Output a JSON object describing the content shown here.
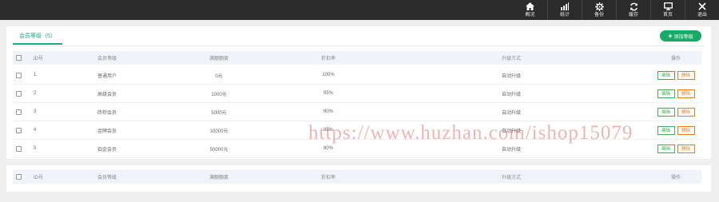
{
  "colors": {
    "topbar": "#2b2b2b",
    "accent": "#1aaa8a",
    "add_button": "#1aaa68",
    "edit": "#3ab54a",
    "delete": "#ef7a1a"
  },
  "topnav": [
    {
      "label": "概况",
      "icon": "home-icon"
    },
    {
      "label": "统计",
      "icon": "bar-chart-icon"
    },
    {
      "label": "备份",
      "icon": "gear-icon"
    },
    {
      "label": "缓存",
      "icon": "refresh-icon"
    },
    {
      "label": "首页",
      "icon": "monitor-icon"
    },
    {
      "label": "退出",
      "icon": "close-icon"
    }
  ],
  "tab": {
    "label": "会员等级（5）"
  },
  "add_button": {
    "label": "添加等级"
  },
  "table": {
    "headers": {
      "id": "ID号",
      "name": "会员等级",
      "amount": "满额额度",
      "discount": "折扣率",
      "upgrade": "升级方式",
      "ops": "操作"
    },
    "rows": [
      {
        "id": "1",
        "name": "普通用户",
        "amount": "0元",
        "discount": "100%",
        "upgrade": "自动升级"
      },
      {
        "id": "2",
        "name": "高级会员",
        "amount": "1000元",
        "discount": "95%",
        "upgrade": "自动升级"
      },
      {
        "id": "3",
        "name": "砖棕会员",
        "amount": "5000元",
        "discount": "90%",
        "upgrade": "自动升级"
      },
      {
        "id": "4",
        "name": "金牌会员",
        "amount": "10000元",
        "discount": "85%",
        "upgrade": "自动升级"
      },
      {
        "id": "5",
        "name": "铂金会员",
        "amount": "50000元",
        "discount": "80%",
        "upgrade": "自动升级"
      }
    ],
    "edit_label": "编辑",
    "delete_label": "删除"
  },
  "watermark": "https://www.huzhan.com/ishop15079"
}
